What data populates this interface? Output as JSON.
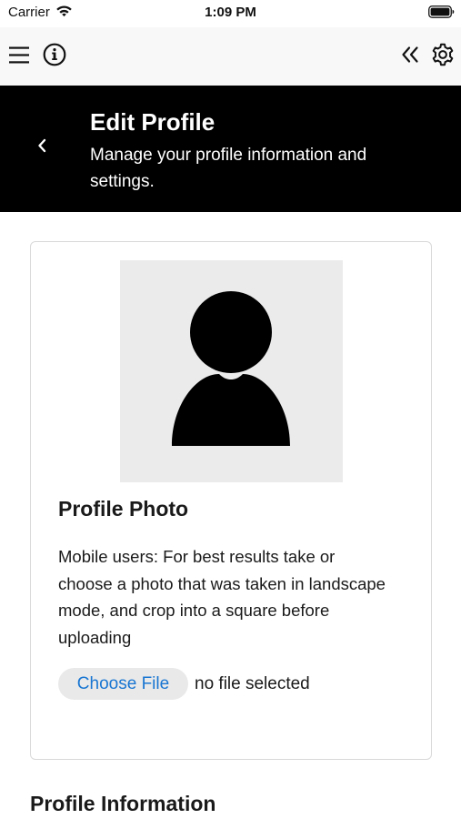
{
  "status_bar": {
    "carrier": "Carrier",
    "time": "1:09 PM",
    "icons": [
      "wifi-icon",
      "battery-icon"
    ]
  },
  "toolbar": {
    "left_icons": [
      "menu-icon",
      "info-icon"
    ],
    "right_icons": [
      "collapse-icon",
      "gear-icon"
    ]
  },
  "header": {
    "title": "Edit Profile",
    "subtitle": "Manage your profile information and settings.",
    "back_icon": "chevron-left-icon",
    "background": "#000000",
    "text_color": "#ffffff"
  },
  "profile_photo": {
    "avatar_icon": "user-silhouette-icon",
    "title": "Profile Photo",
    "help_text": "Mobile users: For best results take or choose a photo that was taken in landscape mode, and crop into a square before uploading",
    "choose_file_label": "Choose File",
    "file_status": "no file selected"
  },
  "profile_information": {
    "title": "Profile Information"
  },
  "colors": {
    "accent": "#1976d2",
    "toolbar_bg": "#f8f8f8",
    "avatar_bg": "#ebebeb",
    "button_bg": "#e9e9e9",
    "card_border": "#d9d9d9"
  }
}
